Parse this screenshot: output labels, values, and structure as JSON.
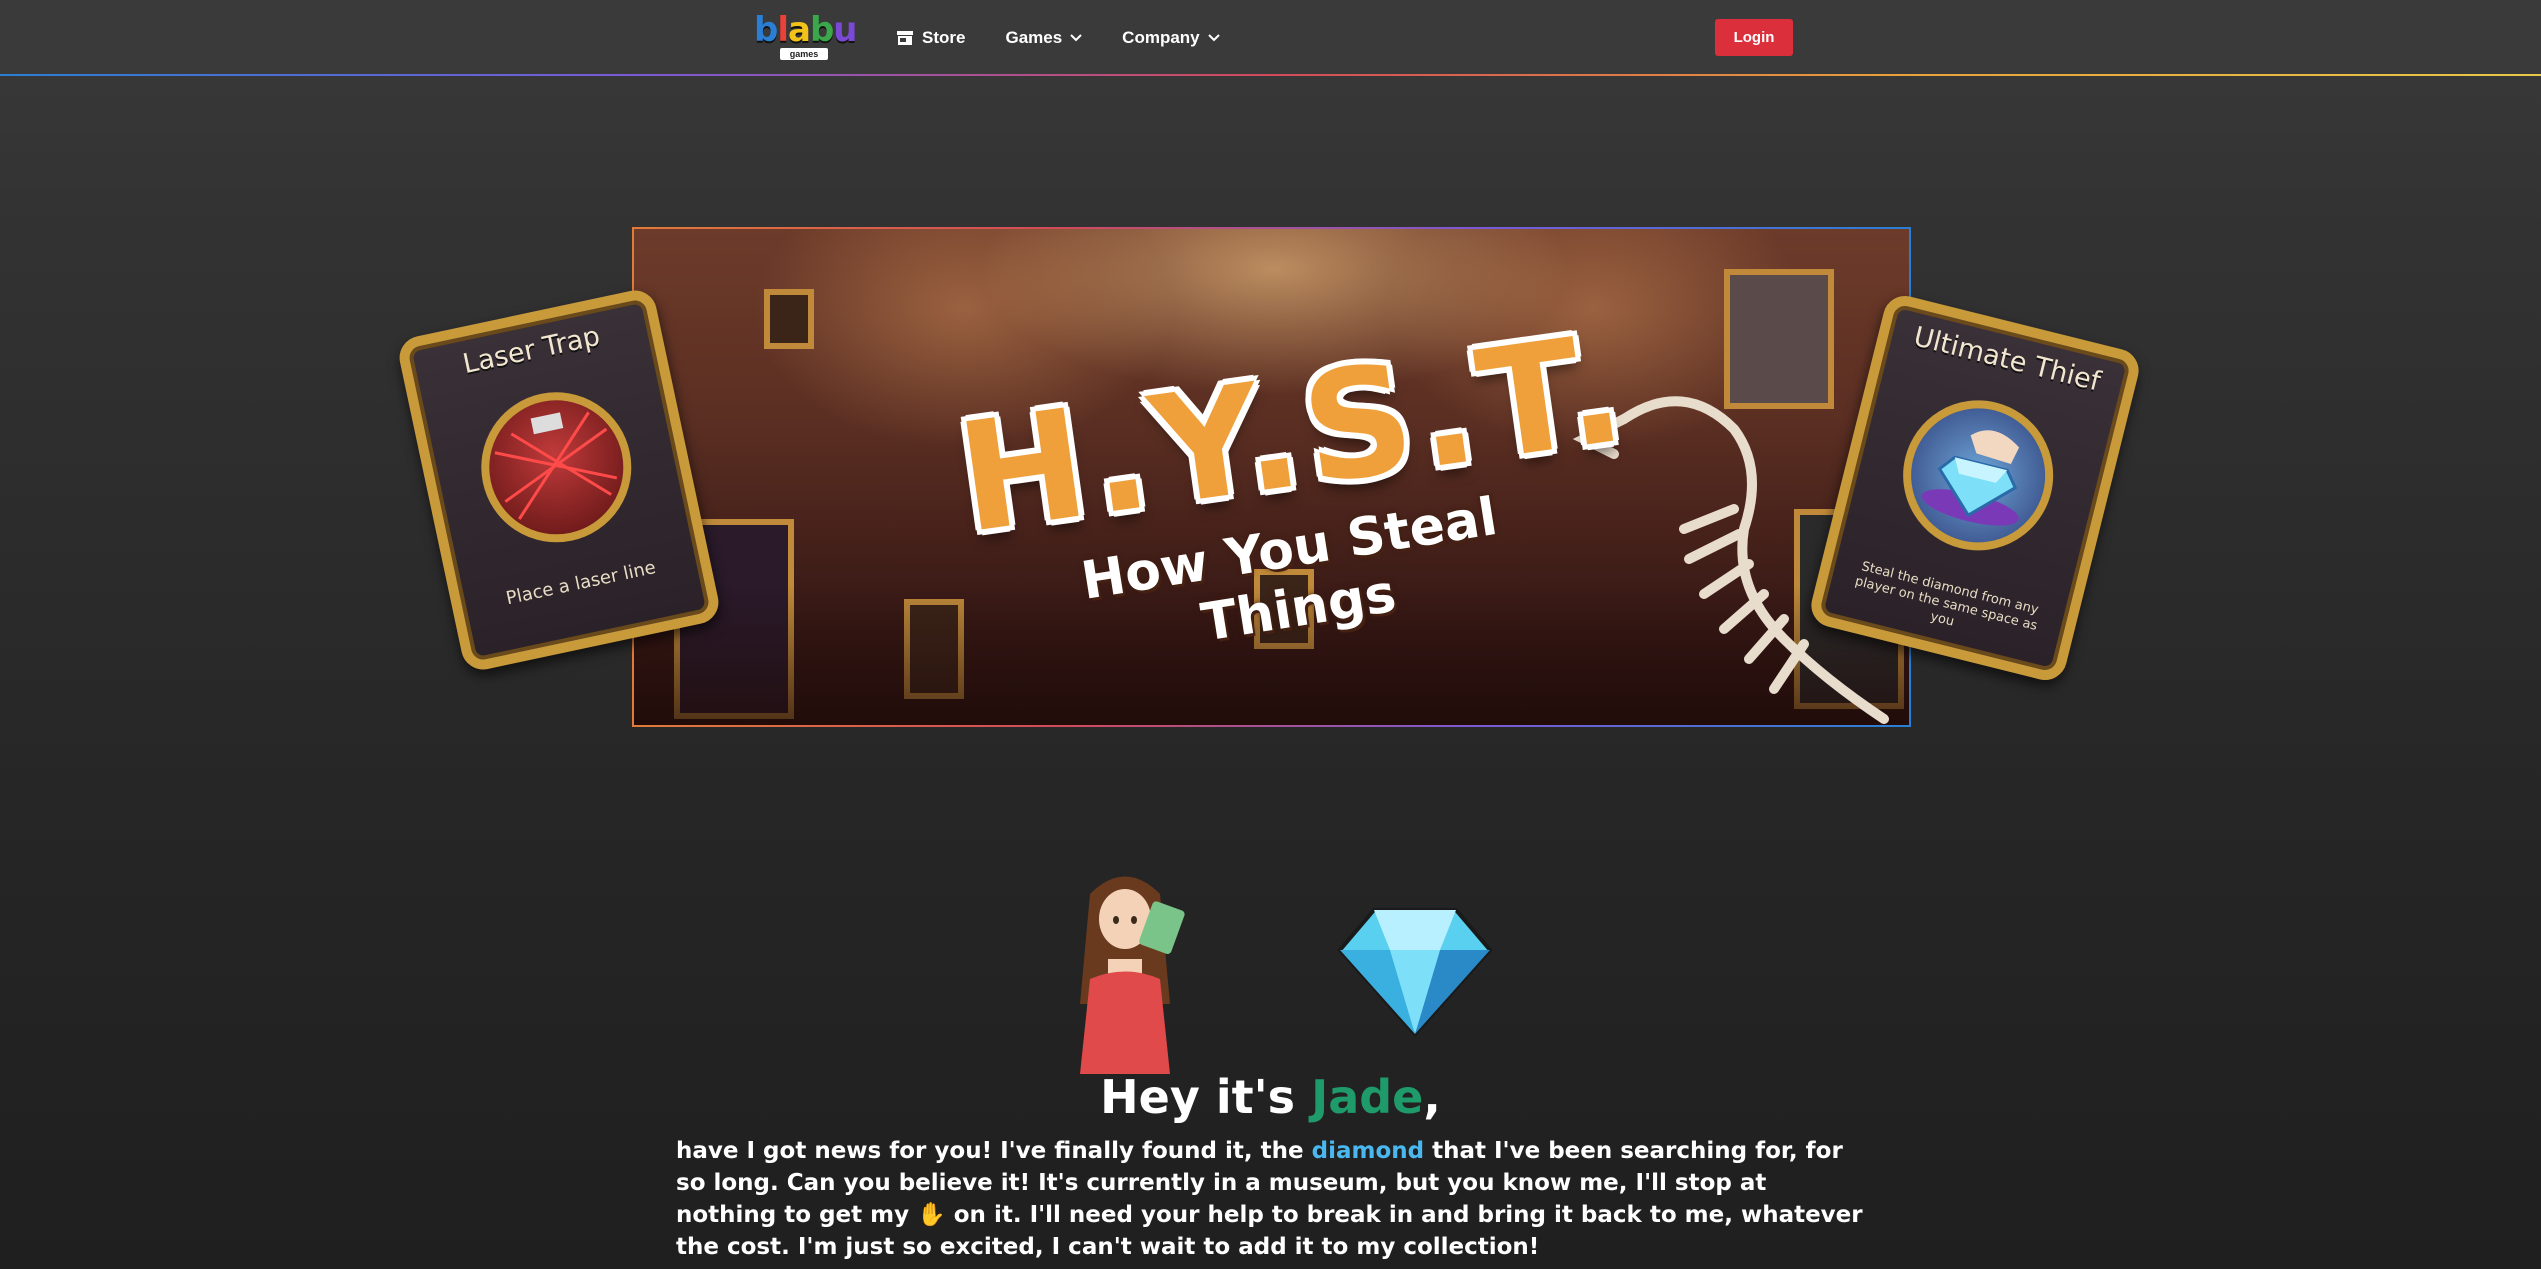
{
  "nav": {
    "logo_text": [
      "b",
      "l",
      "a",
      "b",
      "u"
    ],
    "logo_colors": [
      "#2a7fd4",
      "#e8423a",
      "#f2c21a",
      "#3aa84a",
      "#7a4ad6"
    ],
    "logo_sub": "games",
    "store_label": "Store",
    "games_label": "Games",
    "company_label": "Company",
    "login_label": "Login",
    "login_color": "#dc2f3c"
  },
  "banner": {
    "title": "H.Y.S.T.",
    "subtitle": "How You Steal Things"
  },
  "cards": {
    "left": {
      "title": "Laser Trap",
      "description": "Place a laser line",
      "icon": "laser-trap-icon"
    },
    "right": {
      "title": "Ultimate Thief",
      "description": "Steal the diamond from any player on the same space as you",
      "icon": "diamond-hand-icon"
    }
  },
  "intro": {
    "greeting_prefix": "Hey it's ",
    "greeting_name": "Jade",
    "greeting_suffix": ",",
    "name_color": "#1f9a6a",
    "story_part1": "have I got news for you! I've finally found it, the ",
    "story_highlight": "diamond",
    "highlight_color": "#4ab8f0",
    "story_part2": " that I've been searching for, for so long. Can you believe it! It's currently in a museum, but you know me, I'll stop at nothing to get my ",
    "hand_emoji": "✋",
    "story_part3": " on it. I'll need your help to break in and bring it back to me, whatever the cost. I'm just so excited, I can't wait to add it to my collection!"
  }
}
